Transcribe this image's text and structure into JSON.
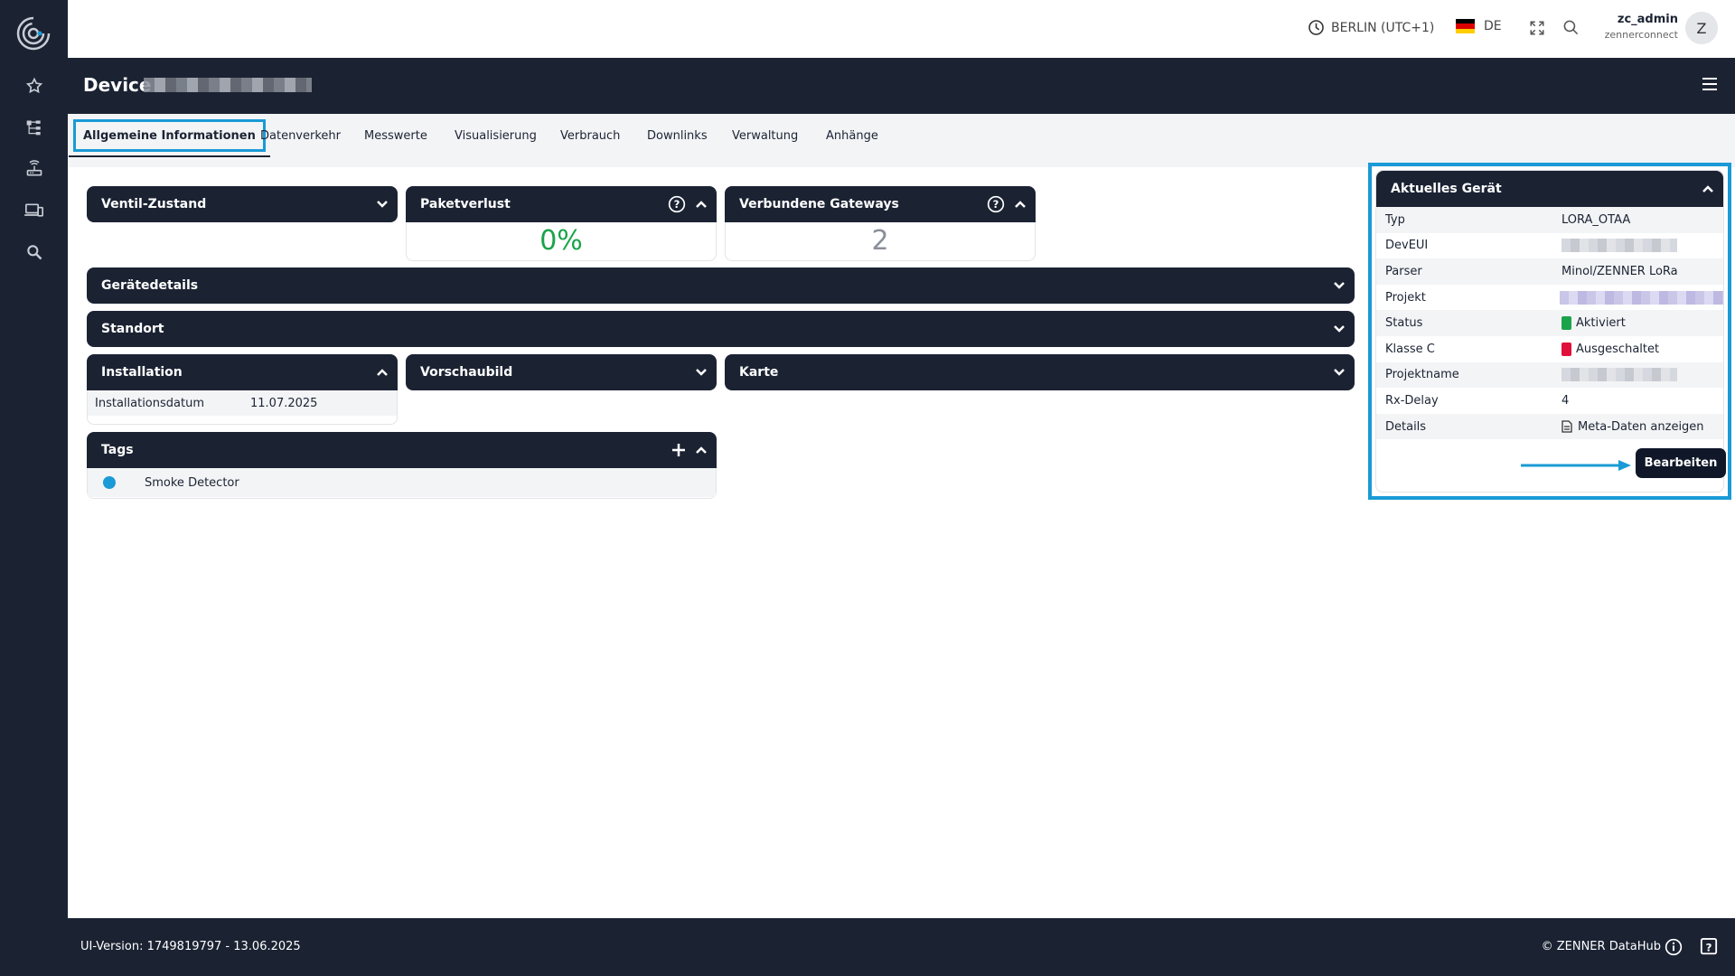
{
  "header": {
    "timezone": "BERLIN (UTC+1)",
    "language": "DE",
    "user_name": "zc_admin",
    "user_org": "zennerconnect",
    "avatar_letter": "Z"
  },
  "title": {
    "label": "Device"
  },
  "tabs": [
    {
      "label": "Allgemeine Informationen"
    },
    {
      "label": "Datenverkehr"
    },
    {
      "label": "Messwerte"
    },
    {
      "label": "Visualisierung"
    },
    {
      "label": "Verbrauch"
    },
    {
      "label": "Downlinks"
    },
    {
      "label": "Verwaltung"
    },
    {
      "label": "Anhänge"
    }
  ],
  "panels": {
    "ventil": {
      "title": "Ventil-Zustand"
    },
    "paket": {
      "title": "Paketverlust",
      "value": "0%"
    },
    "gateways": {
      "title": "Verbundene Gateways",
      "value": "2"
    },
    "geraetedetails": {
      "title": "Gerätedetails"
    },
    "standort": {
      "title": "Standort"
    },
    "installation": {
      "title": "Installation",
      "row_label": "Installationsdatum",
      "row_value": "11.07.2025"
    },
    "vorschau": {
      "title": "Vorschaubild"
    },
    "karte": {
      "title": "Karte"
    },
    "tags": {
      "title": "Tags",
      "items": [
        {
          "label": "Smoke Detector",
          "color": "#1a9ad6"
        }
      ]
    }
  },
  "device": {
    "title": "Aktuelles Gerät",
    "rows": [
      {
        "key": "Typ",
        "value": "LORA_OTAA"
      },
      {
        "key": "DevEUI",
        "value": ""
      },
      {
        "key": "Parser",
        "value": "Minol/ZENNER LoRa"
      },
      {
        "key": "Projekt",
        "value": ""
      },
      {
        "key": "Status",
        "value": "Aktiviert",
        "color": "#1aa34a"
      },
      {
        "key": "Klasse C",
        "value": "Ausgeschaltet",
        "color": "#e0103a"
      },
      {
        "key": "Projektname",
        "value": ""
      },
      {
        "key": "Rx-Delay",
        "value": "4"
      },
      {
        "key": "Details",
        "value": "Meta-Daten anzeigen"
      }
    ],
    "edit_button": "Bearbeiten"
  },
  "footer": {
    "version": "UI-Version: 1749819797 - 13.06.2025",
    "copyright": "© ZENNER DataHub"
  },
  "colors": {
    "navy": "#1b2333",
    "accent": "#1a9ad6",
    "green": "#1aa34a",
    "red": "#e0103a"
  }
}
